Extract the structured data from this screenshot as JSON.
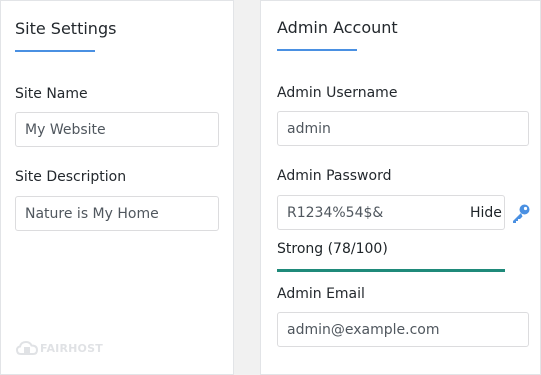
{
  "site": {
    "title": "Site Settings",
    "name_label": "Site Name",
    "name_value": "My Website",
    "desc_label": "Site Description",
    "desc_value": "Nature is My Home"
  },
  "admin": {
    "title": "Admin Account",
    "username_label": "Admin Username",
    "username_value": "admin",
    "password_label": "Admin Password",
    "password_value": "R1234%54$&",
    "hide_label": "Hide",
    "strength_text": "Strong (78/100)",
    "strength_score": 78,
    "email_label": "Admin Email",
    "email_value": "admin@example.com"
  },
  "logo": {
    "text": "FAIRHOST"
  },
  "colors": {
    "accent": "#4a90e2",
    "strength": "#1f8a7a",
    "key_icon": "#4a90e2"
  },
  "icons": {
    "key": "key-icon",
    "cloud": "cloud-icon"
  }
}
